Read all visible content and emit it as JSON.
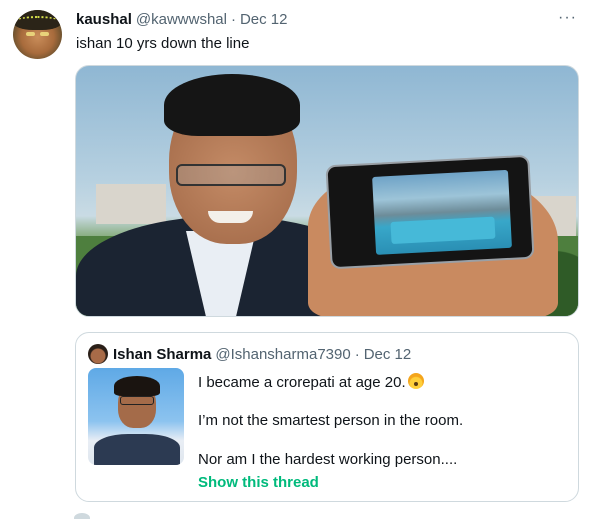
{
  "tweet": {
    "display_name": "kaushal",
    "handle": "@kawwwshal",
    "separator": "·",
    "date": "Dec 12",
    "more_icon": "more-horizontal-icon",
    "text": "ishan 10 yrs down the line"
  },
  "quoted_tweet": {
    "display_name": "Ishan Sharma",
    "handle": "@Ishansharma7390",
    "separator": "·",
    "date": "Dec 12",
    "line1": "I became a crorepati at age 20.",
    "line1_emoji": "exploding-head-emoji",
    "line2": "I’m not the smartest person in the room.",
    "line3": "Nor am I the hardest working person....",
    "show_thread": "Show this thread"
  },
  "colors": {
    "text_primary": "#0f1419",
    "text_secondary": "#536471",
    "border": "#cfd9de",
    "show_thread": "#00ba7c"
  }
}
